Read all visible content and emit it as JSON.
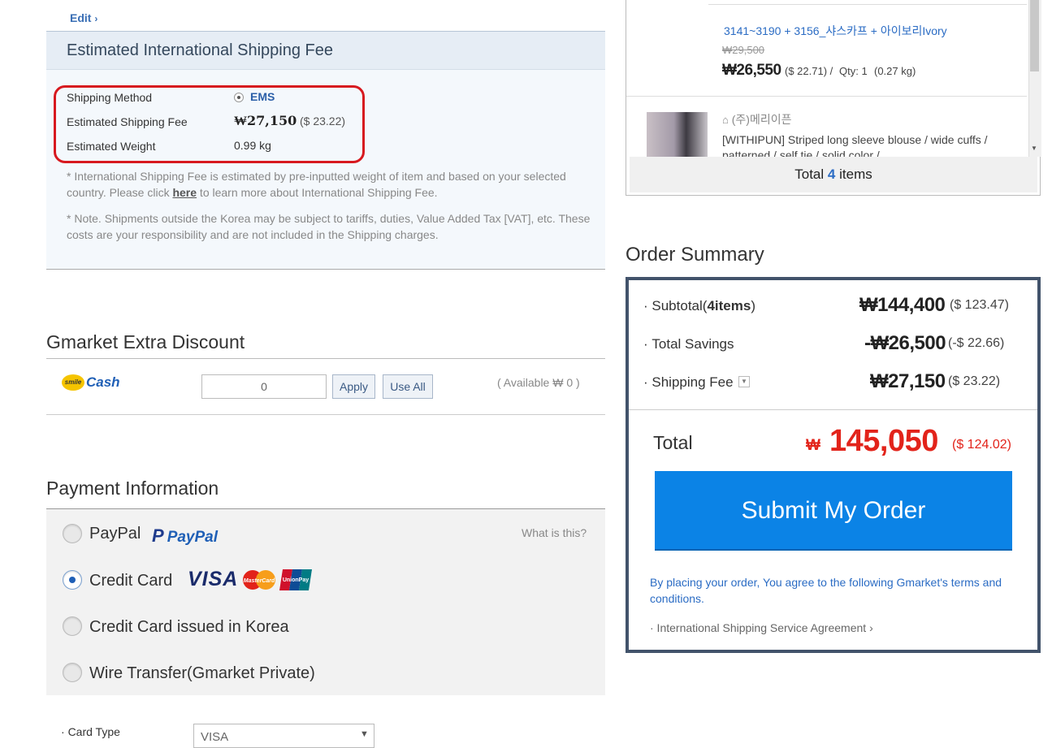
{
  "edit_link": "Edit",
  "shipping": {
    "title": "Estimated International Shipping Fee",
    "method_label": "Shipping Method",
    "method_value": "EMS",
    "fee_label": "Estimated Shipping Fee",
    "fee_value": "₩27,150",
    "fee_usd": "($ 23.22)",
    "weight_label": "Estimated Weight",
    "weight_value": "0.99 kg",
    "note1_a": "* International Shipping Fee is estimated by pre-inputted weight of item and based on your selected country. Please click ",
    "note1_link": "here",
    "note1_b": " to learn more about International Shipping Fee.",
    "note2": "* Note. Shipments outside the Korea may be subject to tariffs, duties, Value Added Tax [VAT], etc. These costs are your responsibility and are not included in the Shipping charges."
  },
  "extra_discount": {
    "title": "Gmarket Extra Discount",
    "logo_smile": "smile",
    "logo_cash": "Cash",
    "input_value": "0",
    "apply": "Apply",
    "use_all": "Use All",
    "available": "( Available ₩ 0 )"
  },
  "payment": {
    "title": "Payment Information",
    "what_is_this": "What is this?",
    "options": [
      {
        "label": "PayPal",
        "logo": "PayPal",
        "checked": false
      },
      {
        "label": "Credit Card",
        "logo": "VISA",
        "checked": true
      },
      {
        "label": "Credit Card issued in Korea",
        "checked": false
      },
      {
        "label": "Wire Transfer(Gmarket Private)",
        "checked": false
      }
    ],
    "card_type_label": "Card Type",
    "card_type_value": "VISA",
    "mastercard_text": "MasterCard",
    "unionpay_text": "UnionPay"
  },
  "cart": {
    "item1": {
      "option": "3141~3190 + 3156_샤스카프 + 아이보리Ivory",
      "original_price": "₩29,500",
      "price": "₩26,550",
      "price_usd": "($ 22.71) /",
      "qty": "Qty: 1",
      "weight": "(0.27 kg)"
    },
    "item2": {
      "seller": "(주)메리이픈",
      "name": "[WITHIPUN] Striped long sleeve blouse / wide cuffs / patterned / self tie / solid color /"
    },
    "total_prefix": "Total",
    "total_count": "4",
    "total_suffix": "items"
  },
  "summary": {
    "title": "Order Summary",
    "subtotal_label": "Subtotal(",
    "subtotal_count": "4items",
    "subtotal_close": ")",
    "subtotal_amount": "₩144,400",
    "subtotal_usd": "($ 123.47)",
    "savings_label": "Total Savings",
    "savings_amount": "-₩26,500",
    "savings_usd": "(-$ 22.66)",
    "fee_label": "Shipping Fee",
    "fee_amount": "₩27,150",
    "fee_usd": "($ 23.22)",
    "total_label": "Total",
    "total_currency": "₩",
    "total_amount": "145,050",
    "total_usd": "($ 124.02)",
    "submit": "Submit My Order",
    "terms": "By placing your order, You agree to the following Gmarket's terms and conditions.",
    "agreement_link": "· International Shipping Service Agreement"
  },
  "colors": {
    "accent": "#0b83e6",
    "total_red": "#e2231a",
    "highlight_red": "#d7191f",
    "summary_border": "#42536b"
  }
}
